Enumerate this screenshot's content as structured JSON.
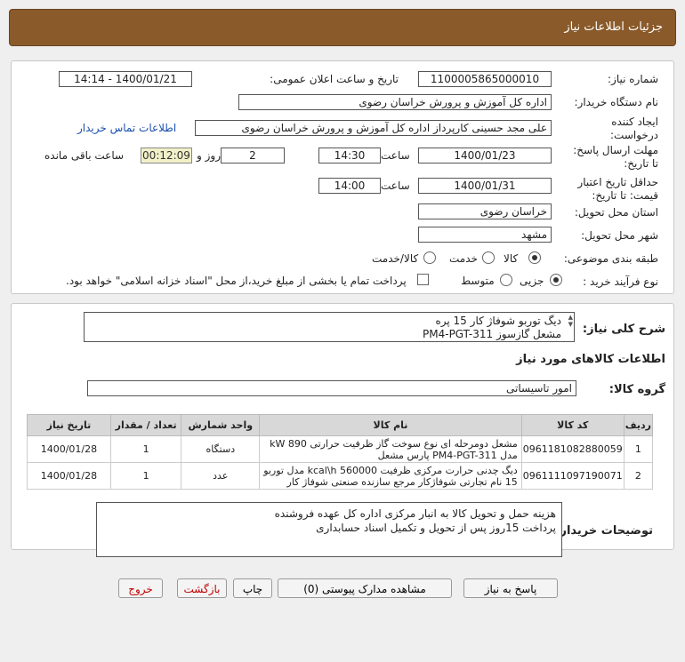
{
  "header": {
    "title": "جزئیات اطلاعات نیاز"
  },
  "details": {
    "need_number_label": "شماره نیاز:",
    "need_number": "1100005865000010",
    "announce_label": "تاریخ و ساعت اعلان عمومی:",
    "announce_value": "1400/01/21 - 14:14",
    "buyer_org_label": "نام دستگاه خریدار:",
    "buyer_org": "اداره کل آموزش و پرورش خراسان رضوی",
    "requester_label_1": "ایجاد کننده",
    "requester_label_2": "درخواست:",
    "requester": "علی مجد حسینی کارپرداز اداره کل آموزش و پرورش خراسان رضوی",
    "contact_link": "اطلاعات تماس خریدار",
    "deadline_label_1": "مهلت ارسال پاسخ:",
    "deadline_label_2": "تا تاریخ:",
    "deadline_date": "1400/01/23",
    "time_label": "ساعت",
    "deadline_time": "14:30",
    "day_label": "روز و",
    "days_left": "2",
    "timer": "00:12:09",
    "remaining_label": "ساعت باقی مانده",
    "validity_label_1": "حداقل تاریخ اعتبار",
    "validity_label_2": "قیمت: تا تاریخ:",
    "validity_date": "1400/01/31",
    "validity_time": "14:00",
    "province_label": "استان محل تحویل:",
    "province": "خراسان رضوی",
    "city_label": "شهر محل تحویل:",
    "city": "مشهد",
    "category_label": "طبقه بندی موضوعی:",
    "category_options": [
      "کالا",
      "خدمت",
      "کالا/خدمت"
    ],
    "purchase_label": "نوع فرآیند خرید :",
    "purchase_options": [
      "جزیی",
      "متوسط"
    ],
    "payment_note": "پرداخت تمام یا بخشی از مبلغ خرید،از محل \"اسناد خزانه اسلامی\" خواهد بود."
  },
  "summary": {
    "label": "شرح کلی نیاز:",
    "line1": "دیگ توربو شوفاژ کار 15 پره",
    "line2": "مشعل گازسوز PM4-PGT-311"
  },
  "goods_section_title": "اطلاعات کالاهای مورد نیاز",
  "goods_group_label": "گروه کالا:",
  "goods_group": "امور تاسیساتی",
  "table": {
    "headers": [
      "ردیف",
      "کد کالا",
      "نام کالا",
      "واحد شمارش",
      "تعداد / مقدار",
      "تاریخ نیاز"
    ],
    "rows": [
      {
        "index": "1",
        "code": "0961181082880059",
        "name_1": "مشعل دومرحله ای نوع سوخت گاز ظرفیت حرارتی kW 890",
        "name_2": "مدل PM4-PGT-311 پارس مشعل",
        "unit": "دستگاه",
        "qty": "1",
        "date": "1400/01/28"
      },
      {
        "index": "2",
        "code": "0961111097190071",
        "name_1": "دیگ چدنی حرارت مرکزی ظرفیت kcal\\h 560000 مدل توربو",
        "name_2": "15 نام تجارتی شوفاژکار مرجع سازنده صنعتی شوفاژ کار",
        "unit": "عدد",
        "qty": "1",
        "date": "1400/01/28"
      }
    ]
  },
  "buyer_notes": {
    "label": "توضیحات خریدار:",
    "line1": "هزینه حمل و تحویل کالا به انبار مرکزی اداره کل عهده فروشنده",
    "line2": "پرداخت 15روز پس از تحویل و تکمیل اسناد حسابداری"
  },
  "buttons": {
    "reply": "پاسخ به نیاز",
    "attachments": "مشاهده مدارک پیوستی (0)",
    "print": "چاپ",
    "back": "بازگشت",
    "exit": "خروج"
  }
}
